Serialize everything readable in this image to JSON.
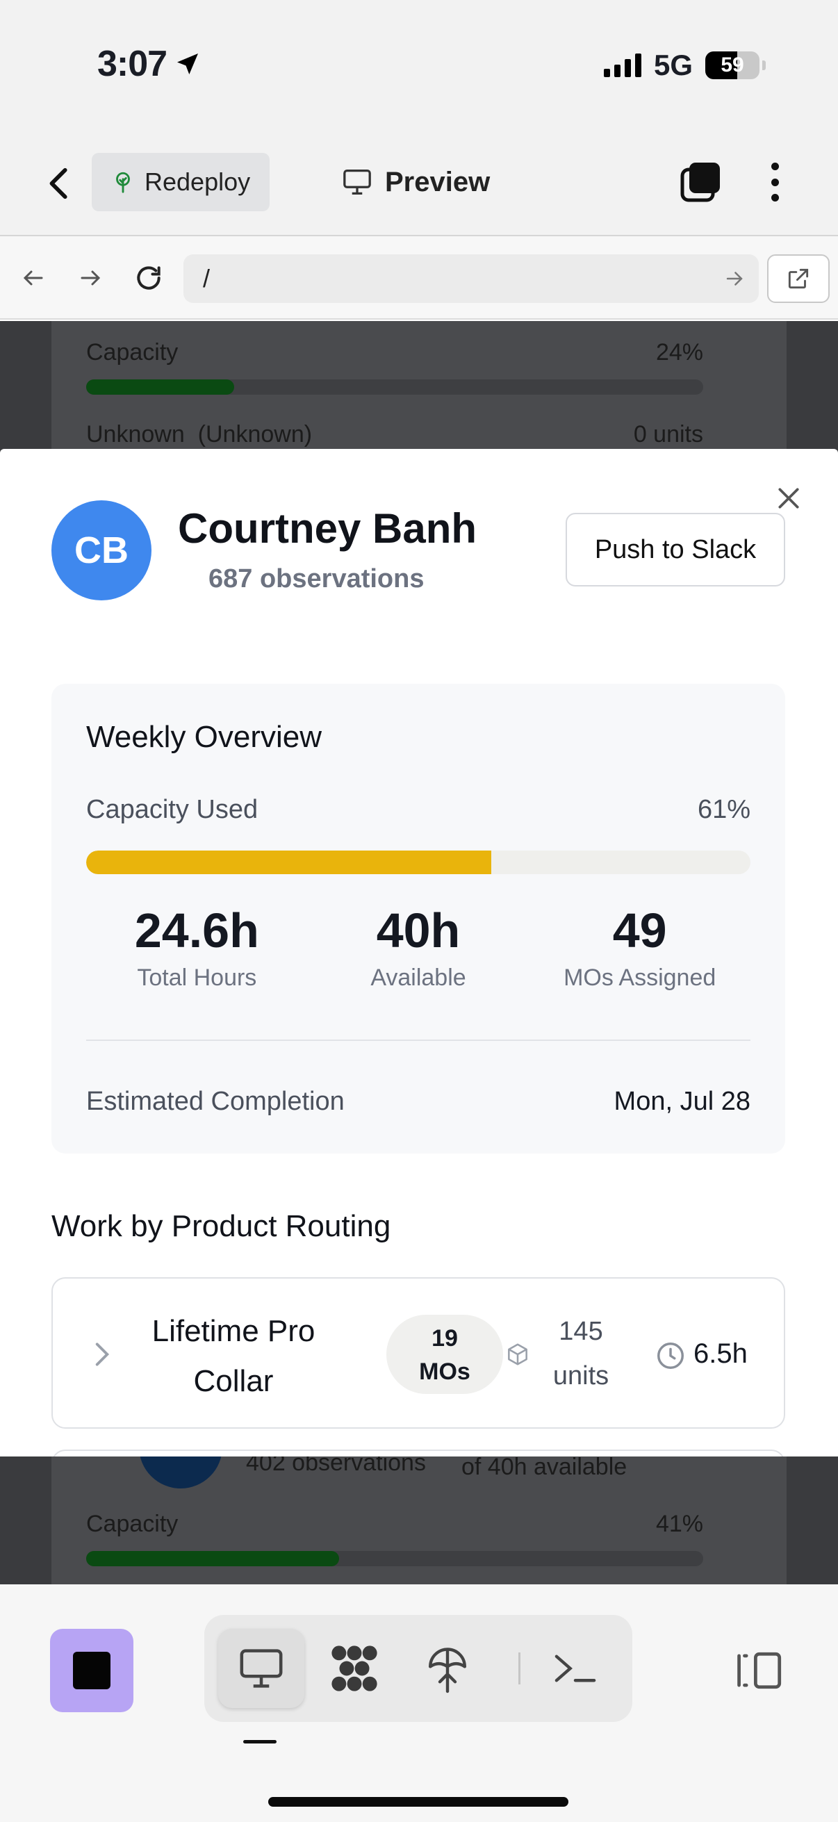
{
  "status_bar": {
    "time": "3:07",
    "network": "5G",
    "battery": "59"
  },
  "app_bar": {
    "redeploy_label": "Redeploy",
    "preview_label": "Preview"
  },
  "browser": {
    "url": "/"
  },
  "background": {
    "row1_label": "Capacity",
    "row1_value": "24%",
    "row1_fill": 0.24,
    "row2_label": "Unknown",
    "row2_sub": "(Unknown)",
    "row2_value": "0 units",
    "card2_obs": "402 observations",
    "card2_avail": "of 40h available",
    "row3_label": "Capacity",
    "row3_value": "41%",
    "row3_fill": 0.41
  },
  "modal": {
    "avatar_initials": "CB",
    "name": "Courtney Banh",
    "observations": "687 observations",
    "push_label": "Push to Slack",
    "overview": {
      "title": "Weekly Overview",
      "capacity_label": "Capacity Used",
      "capacity_value": "61%",
      "capacity_fraction": 0.61,
      "stats": [
        {
          "value": "24.6h",
          "label": "Total Hours"
        },
        {
          "value": "40h",
          "label": "Available"
        },
        {
          "value": "49",
          "label": "MOs Assigned"
        }
      ],
      "estimated_label": "Estimated Completion",
      "estimated_value": "Mon, Jul 28"
    },
    "routing_title": "Work by Product Routing",
    "routes": [
      {
        "name": "Lifetime Pro Collar",
        "mo_count": "19",
        "mo_unit": "MOs",
        "units_count": "145",
        "units_label": "units",
        "hours": "6.5h"
      }
    ]
  },
  "colors": {
    "avatar": "#3f88ee",
    "capacity_bar": "#e9b40c",
    "stop_button": "#b7a4f4"
  }
}
